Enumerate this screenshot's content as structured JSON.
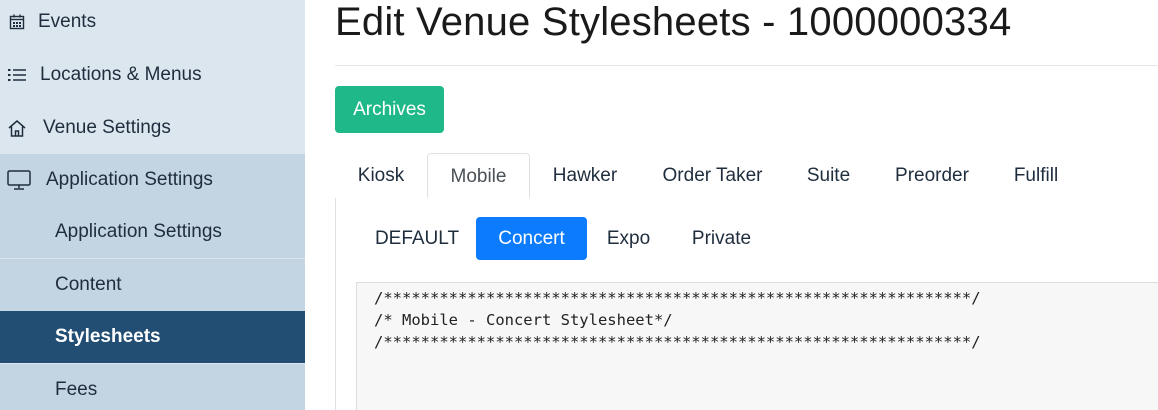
{
  "sidebar": {
    "items": [
      {
        "label": "Events",
        "icon": "calendar-icon"
      },
      {
        "label": "Locations & Menus",
        "icon": "list-icon"
      },
      {
        "label": "Venue Settings",
        "icon": "home-icon"
      },
      {
        "label": "Application Settings",
        "icon": "monitor-icon"
      }
    ],
    "subitems": [
      {
        "label": "Application Settings"
      },
      {
        "label": "Content"
      },
      {
        "label": "Stylesheets"
      },
      {
        "label": "Fees"
      }
    ]
  },
  "main": {
    "title": "Edit Venue Stylesheets - 1000000334",
    "archives_label": "Archives",
    "tabs": [
      "Kiosk",
      "Mobile",
      "Hawker",
      "Order Taker",
      "Suite",
      "Preorder",
      "Fulfill"
    ],
    "active_tab": "Mobile",
    "pills": [
      "DEFAULT",
      "Concert",
      "Expo",
      "Private"
    ],
    "active_pill": "Concert",
    "editor_lines": [
      "/***************************************************************/",
      "/* Mobile - Concert Stylesheet*/",
      "/***************************************************************/"
    ]
  },
  "colors": {
    "sidebar_bg": "#dce6ef",
    "sidebar_group_bg": "#c3d4e3",
    "sidebar_active_bg": "#234e73",
    "archives_green": "#1fb889",
    "pill_active_blue": "#0d7bfd"
  }
}
